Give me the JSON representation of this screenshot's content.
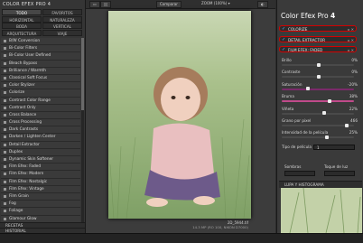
{
  "app": {
    "panel_title": "COLOR EFEX PRO 4"
  },
  "categories": [
    {
      "label": "TODO",
      "active": true
    },
    {
      "label": "FAVORITOS",
      "active": false
    },
    {
      "label": "HORIZONTAL",
      "active": false
    },
    {
      "label": "NATURALEZA",
      "active": false
    },
    {
      "label": "BODA",
      "active": false
    },
    {
      "label": "VERTICAL",
      "active": false
    },
    {
      "label": "ARQUITECTURA",
      "active": false
    },
    {
      "label": "VIAJE",
      "active": false
    }
  ],
  "filters": [
    "B/W Conversion",
    "Bi-Color Filters",
    "Bi-Color User Defined",
    "Bleach Bypass",
    "Brilliance / Warmth",
    "Classical Soft Focus",
    "Color Stylizer",
    "Colorize",
    "Contrast Color Range",
    "Contrast Only",
    "Cross Balance",
    "Cross Processing",
    "Dark Contrasts",
    "Darken / Lighten Center",
    "Detail Extractor",
    "Duplex",
    "Dynamic Skin Softener",
    "Film Efex: Faded",
    "Film Efex: Modern",
    "Film Efex: Nostalgic",
    "Film Efex: Vintage",
    "Film Grain",
    "Fog",
    "Foliage",
    "Glamour Glow",
    "Graduated Filters",
    "Graduated Fog"
  ],
  "left_footer": {
    "recipes": "RECETAS",
    "history": "HISTORIAL"
  },
  "center": {
    "compare": "Comparar",
    "zoom": "ZOOM (100%)",
    "info_name": "2D_5944.tif",
    "info_meta": "14.3 MP (RO 100, NIKON D7000)"
  },
  "right": {
    "title_main": "Color Efex Pro",
    "title_num": "4",
    "filter_heads": [
      "COLORIZE",
      "DETAIL EXTRACTOR",
      "FILM EFEX: FADED"
    ],
    "sliders": [
      {
        "label": "Brillo",
        "value": "0%",
        "pos": 0.5,
        "track": "#4a4a4a"
      },
      {
        "label": "Contraste",
        "value": "0%",
        "pos": 0.5,
        "track": "#4a4a4a"
      },
      {
        "label": "Saturación",
        "value": "-20%",
        "pos": 0.35,
        "track": "#7a2a6a"
      },
      {
        "label": "Bruma",
        "value": "38%",
        "pos": 0.65,
        "track": "#c04a8a"
      },
      {
        "label": "Viñeta",
        "value": "22%",
        "pos": 0.58,
        "track": "#4a4a4a"
      },
      {
        "label": "Grano por pixel",
        "value": "466",
        "pos": 0.9,
        "track": "#4a4a4a"
      },
      {
        "label": "Intensidad de la película",
        "value": "25%",
        "pos": 0.62,
        "track": "#4a4a4a"
      }
    ],
    "film_type_label": "Tipo de película",
    "film_type_value": "1",
    "shadows_label": "Sombras",
    "highlights_label": "Toque de luz",
    "loupe": "LUPA Y HISTOGRAMA"
  },
  "colors": {
    "accent_red": "#d40000",
    "check": "#5fb0ff"
  }
}
